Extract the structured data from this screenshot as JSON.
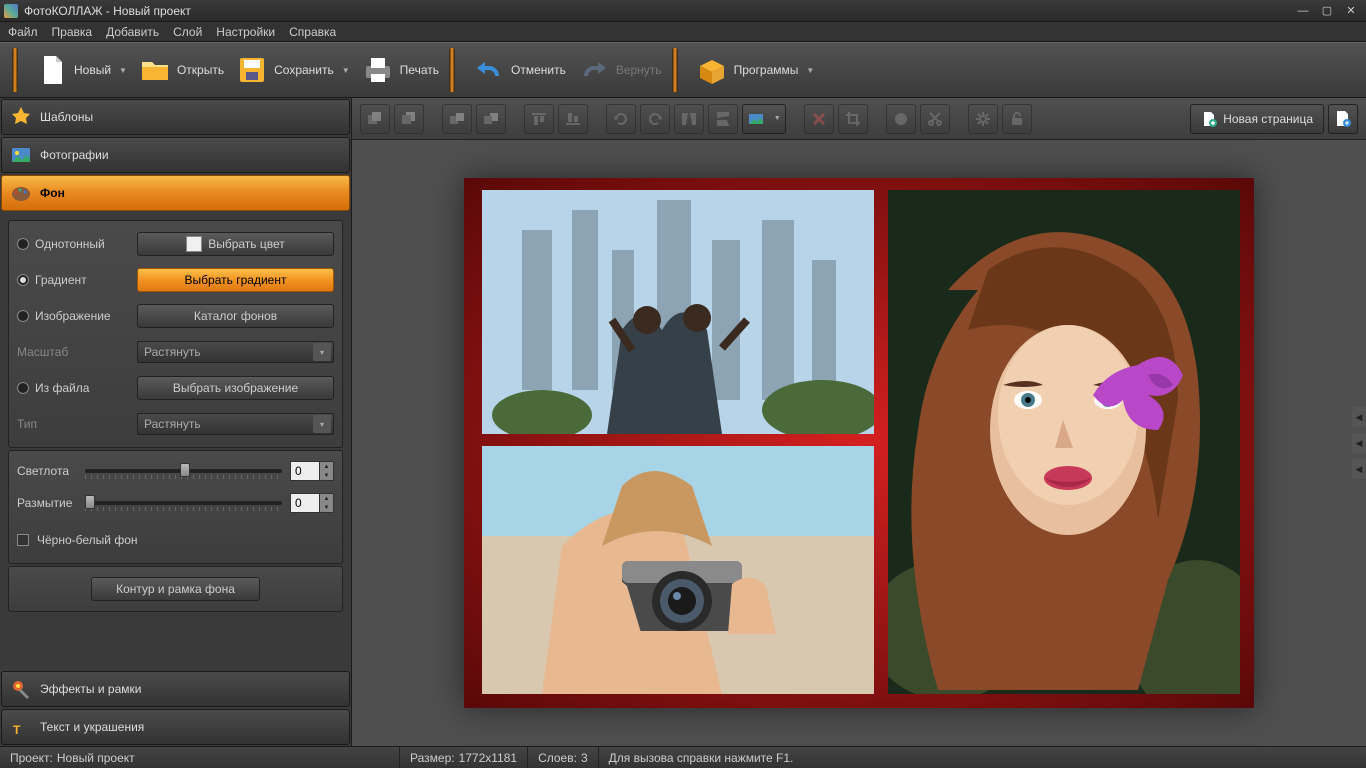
{
  "title": "ФотоКОЛЛАЖ - Новый проект",
  "menu": [
    "Файл",
    "Правка",
    "Добавить",
    "Слой",
    "Настройки",
    "Справка"
  ],
  "toolbar": {
    "new": "Новый",
    "open": "Открыть",
    "save": "Сохранить",
    "print": "Печать",
    "undo": "Отменить",
    "redo": "Вернуть",
    "programs": "Программы"
  },
  "accordion": {
    "templates": "Шаблоны",
    "photos": "Фотографии",
    "background": "Фон",
    "effects": "Эффекты и рамки",
    "text": "Текст и украшения"
  },
  "bg_panel": {
    "solid": "Однотонный",
    "pick_color": "Выбрать цвет",
    "gradient": "Градиент",
    "pick_gradient": "Выбрать градиент",
    "image": "Изображение",
    "bg_catalog": "Каталог фонов",
    "scale": "Масштаб",
    "stretch": "Растянуть",
    "from_file": "Из файла",
    "pick_image": "Выбрать изображение",
    "type": "Тип",
    "brightness": "Светлота",
    "brightness_val": "0",
    "blur": "Размытие",
    "blur_val": "0",
    "bw": "Чёрно-белый фон",
    "outline": "Контур и рамка фона"
  },
  "canvas_toolbar": {
    "new_page": "Новая страница"
  },
  "status": {
    "project_label": "Проект:",
    "project": "Новый проект",
    "size_label": "Размер:",
    "size": "1772x1181",
    "layers_label": "Слоев:",
    "layers": "3",
    "help": "Для вызова справки нажмите F1."
  }
}
